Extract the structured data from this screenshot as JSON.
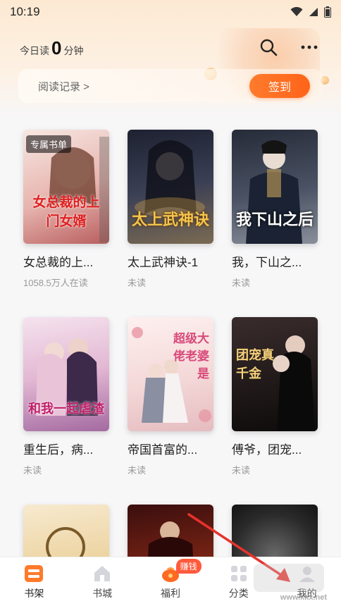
{
  "status_bar": {
    "time": "10:19"
  },
  "header": {
    "reading_prefix": "今日读",
    "reading_minutes": "0",
    "reading_suffix": "分钟",
    "reading_record": "阅读记录 >",
    "checkin_label": "签到"
  },
  "books": [
    {
      "title": "女总裁的上...",
      "subtitle": "1058.5万人在读",
      "badge": "专属书单",
      "cover_text": "女总裁的上门女婿",
      "colors": [
        "#f1d9d4",
        "#c77b7b"
      ]
    },
    {
      "title": "太上武神诀-1",
      "subtitle": "未读",
      "cover_text": "太上武神诀",
      "colors": [
        "#2a2e3d",
        "#6a6f8a"
      ]
    },
    {
      "title": "我，下山之...",
      "subtitle": "未读",
      "cover_text": "我下山之后",
      "colors": [
        "#1c2230",
        "#5a6478"
      ]
    },
    {
      "title": "重生后，病...",
      "subtitle": "未读",
      "cover_text": "和我一起虐渣",
      "colors": [
        "#f0d7e6",
        "#b87ab0"
      ]
    },
    {
      "title": "帝国首富的...",
      "subtitle": "未读",
      "cover_text": "超级大佬老婆是",
      "colors": [
        "#fbe9ea",
        "#e7c6c9"
      ]
    },
    {
      "title": "傅爷，团宠...",
      "subtitle": "未读",
      "cover_text": "团宠真千金",
      "colors": [
        "#2b2020",
        "#6b4a3a"
      ]
    },
    {
      "title": "",
      "subtitle": "",
      "cover_text": "",
      "colors": [
        "#f4e3b8",
        "#d8b070"
      ]
    },
    {
      "title": "",
      "subtitle": "",
      "cover_text": "",
      "colors": [
        "#2a1010",
        "#9a3a20"
      ]
    },
    {
      "title": "",
      "subtitle": "",
      "cover_text": "",
      "colors": [
        "#1a1a1a",
        "#5a5a5a"
      ]
    }
  ],
  "tabbar": {
    "tabs": [
      {
        "label": "书架",
        "icon": "bookshelf-icon"
      },
      {
        "label": "书城",
        "icon": "bookstore-icon"
      },
      {
        "label": "福利",
        "icon": "gift-icon",
        "badge": "赚钱"
      },
      {
        "label": "分类",
        "icon": "category-icon"
      },
      {
        "label": "我的",
        "icon": "profile-icon"
      }
    ]
  },
  "watermark": "www.kkx.net",
  "colors": {
    "accent": "#ff6a22",
    "header_bg": "#fde9d2"
  }
}
